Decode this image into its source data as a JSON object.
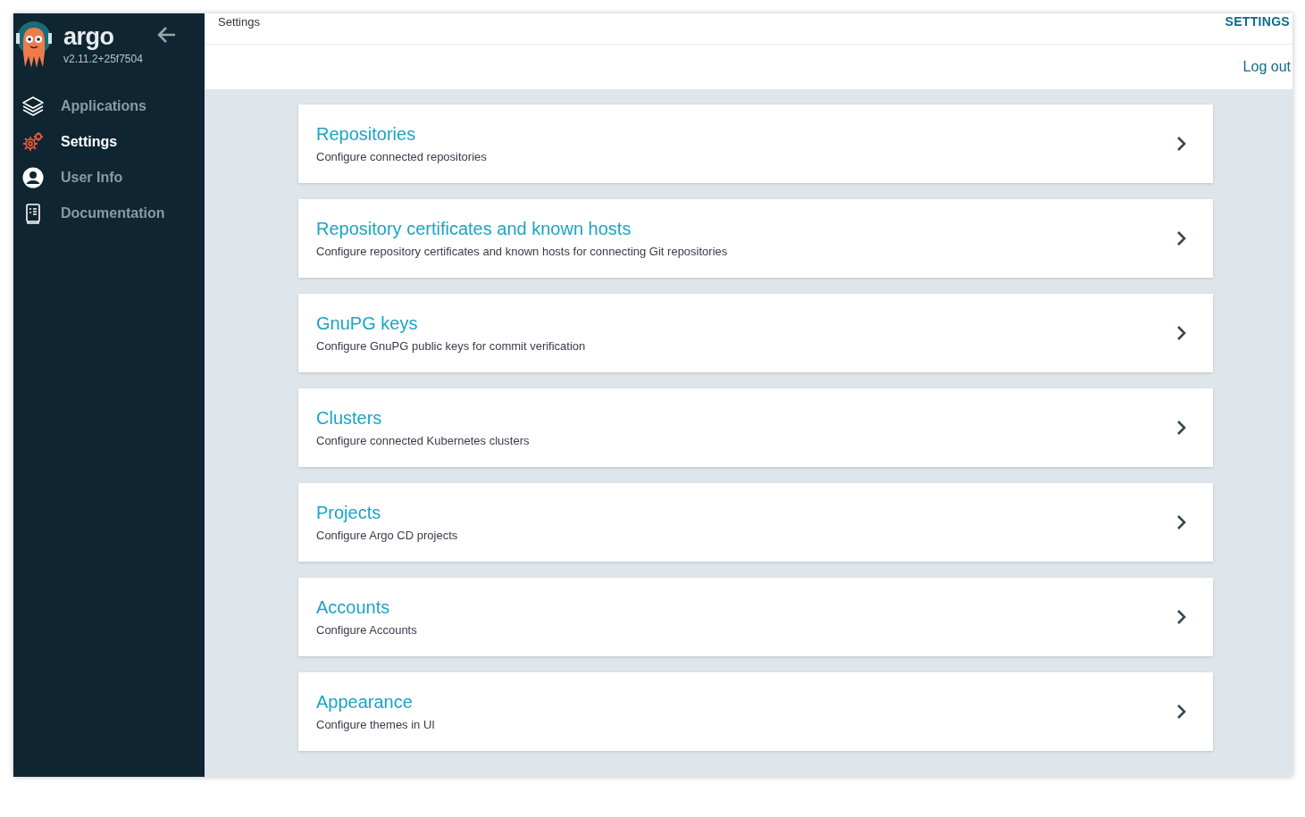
{
  "sidebar": {
    "logo": {
      "name": "argo",
      "version": "v2.11.2+25f7504"
    },
    "items": [
      {
        "kind": "layers",
        "label": "Applications",
        "selected": false
      },
      {
        "kind": "gears",
        "label": "Settings",
        "selected": true
      },
      {
        "kind": "user",
        "label": "User Info",
        "selected": false
      },
      {
        "kind": "docs",
        "label": "Documentation",
        "selected": false
      }
    ]
  },
  "top_bar": {
    "breadcrumb": "Settings",
    "title": "SETTINGS",
    "logout": "Log out"
  },
  "settings": [
    {
      "title": "Repositories",
      "description": "Configure connected repositories"
    },
    {
      "title": "Repository certificates and known hosts",
      "description": "Configure repository certificates and known hosts for connecting Git repositories"
    },
    {
      "title": "GnuPG keys",
      "description": "Configure GnuPG public keys for commit verification"
    },
    {
      "title": "Clusters",
      "description": "Configure connected Kubernetes clusters"
    },
    {
      "title": "Projects",
      "description": "Configure Argo CD projects"
    },
    {
      "title": "Accounts",
      "description": "Configure Accounts"
    },
    {
      "title": "Appearance",
      "description": "Configure themes in UI"
    }
  ]
}
